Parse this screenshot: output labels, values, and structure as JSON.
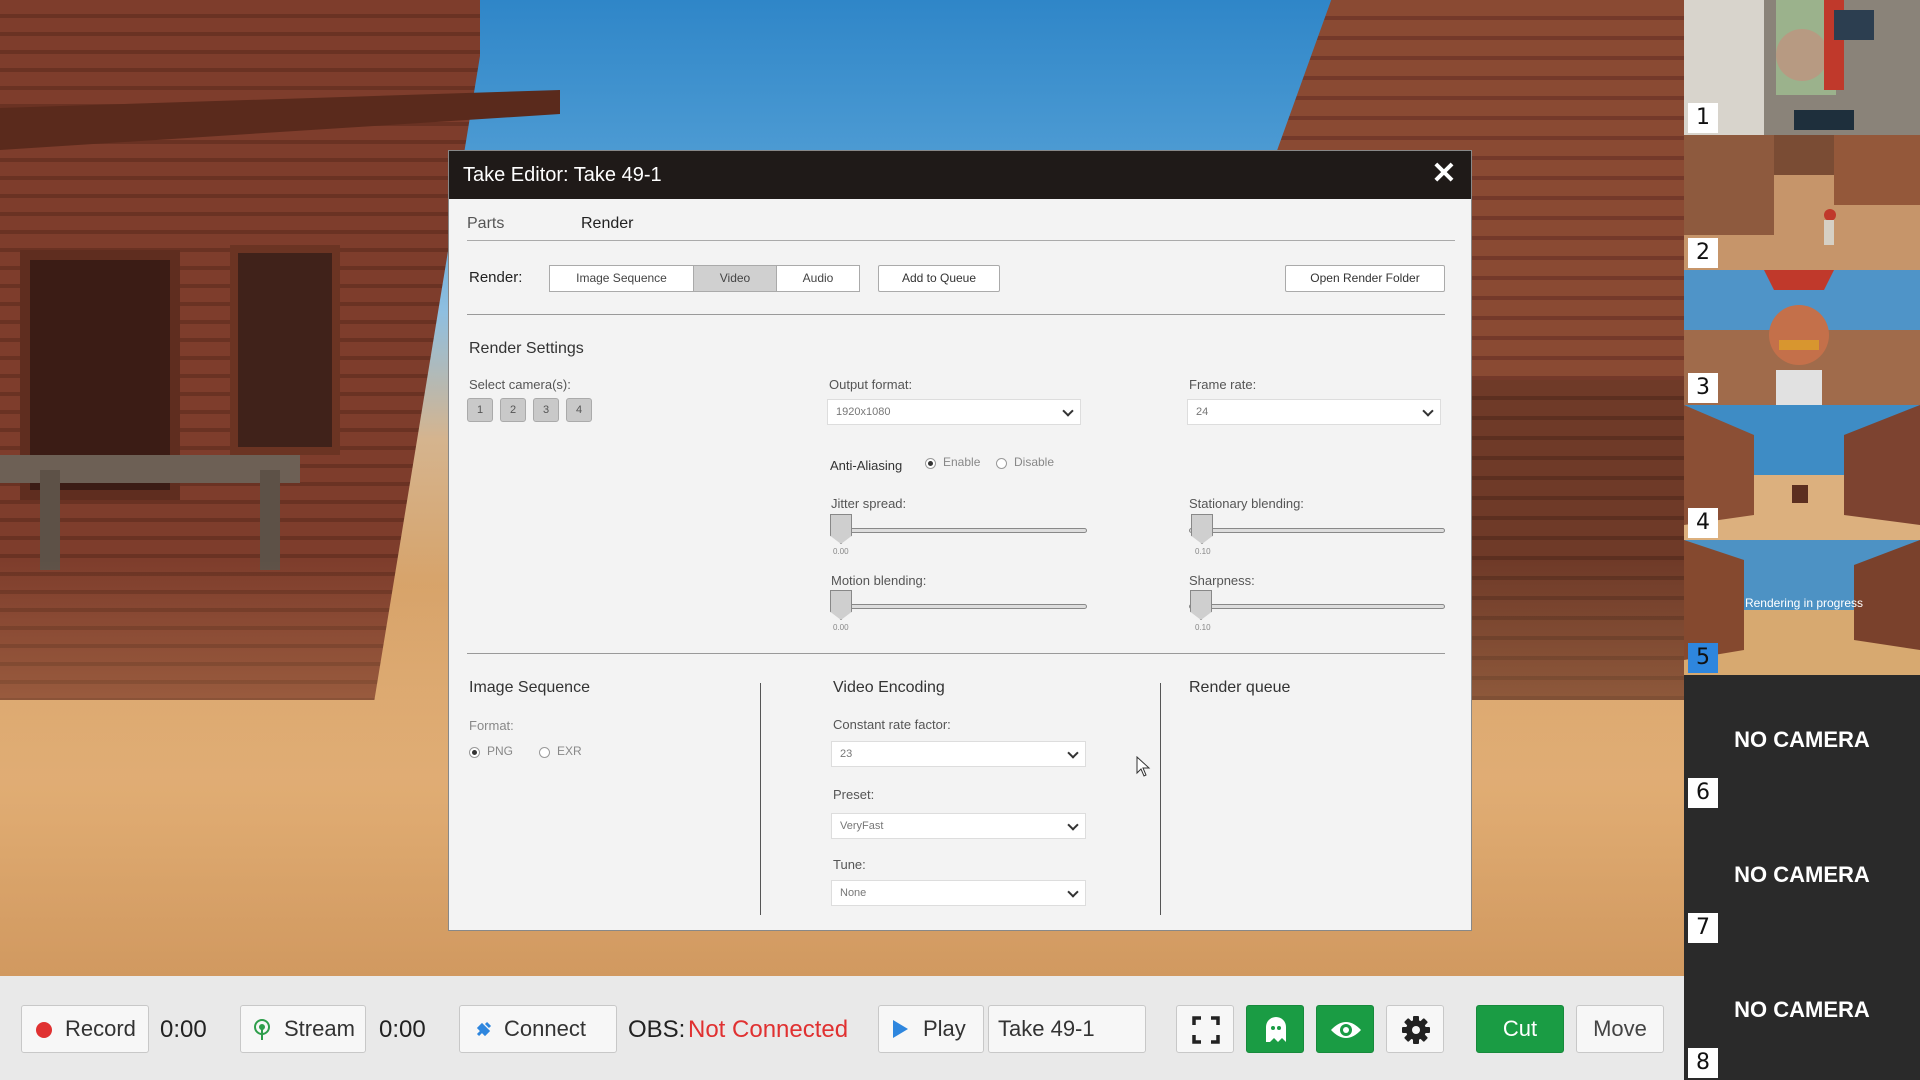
{
  "dialog": {
    "title": "Take Editor: Take 49-1",
    "close_glyph": "✕",
    "tabs": [
      {
        "label": "Parts",
        "active": false
      },
      {
        "label": "Render",
        "active": true
      }
    ],
    "render_label": "Render:",
    "render_modes": [
      "Image Sequence",
      "Video",
      "Audio"
    ],
    "render_mode_selected": "Video",
    "add_to_queue": "Add to Queue",
    "open_render_folder": "Open Render Folder",
    "render_settings": {
      "title": "Render Settings",
      "select_cameras_label": "Select camera(s):",
      "cameras": [
        "1",
        "2",
        "3",
        "4"
      ],
      "output_format_label": "Output format:",
      "output_format_value": "1920x1080",
      "frame_rate_label": "Frame rate:",
      "frame_rate_value": "24",
      "anti_aliasing_label": "Anti-Aliasing",
      "anti_aliasing_enable": "Enable",
      "anti_aliasing_disable": "Disable",
      "anti_aliasing_selected": "Enable",
      "jitter_spread_label": "Jitter spread:",
      "jitter_spread_value": "0.00",
      "motion_blending_label": "Motion blending:",
      "motion_blending_value": "0.00",
      "stationary_blending_label": "Stationary blending:",
      "stationary_blending_value": "0.10",
      "sharpness_label": "Sharpness:",
      "sharpness_value": "0.10"
    },
    "image_sequence": {
      "title": "Image Sequence",
      "format_label": "Format:",
      "format_png": "PNG",
      "format_exr": "EXR",
      "format_selected": "PNG"
    },
    "video_encoding": {
      "title": "Video Encoding",
      "crf_label": "Constant rate factor:",
      "crf_value": "23",
      "preset_label": "Preset:",
      "preset_value": "VeryFast",
      "tune_label": "Tune:",
      "tune_value": "None"
    },
    "render_queue": {
      "title": "Render queue"
    }
  },
  "toolbar": {
    "record_label": "Record",
    "record_time": "0:00",
    "stream_label": "Stream",
    "stream_time": "0:00",
    "connect_label": "Connect",
    "obs_label": "OBS:",
    "obs_status": "Not Connected",
    "play_label": "Play",
    "take_name": "Take 49-1",
    "cut_label": "Cut",
    "move_label": "Move",
    "colors": {
      "record": "#e03131",
      "obs_status": "#e03131",
      "green": "#1a9c44",
      "connect_icon": "#2e86de"
    }
  },
  "cameras": [
    {
      "num": "1",
      "no_camera": ""
    },
    {
      "num": "2",
      "no_camera": ""
    },
    {
      "num": "3",
      "no_camera": ""
    },
    {
      "num": "4",
      "no_camera": ""
    },
    {
      "num": "5",
      "no_camera": "",
      "active": true,
      "overlay": "Rendering in progress"
    },
    {
      "num": "6",
      "no_camera": "NO CAMERA"
    },
    {
      "num": "7",
      "no_camera": "NO CAMERA"
    },
    {
      "num": "8",
      "no_camera": "NO CAMERA"
    }
  ]
}
